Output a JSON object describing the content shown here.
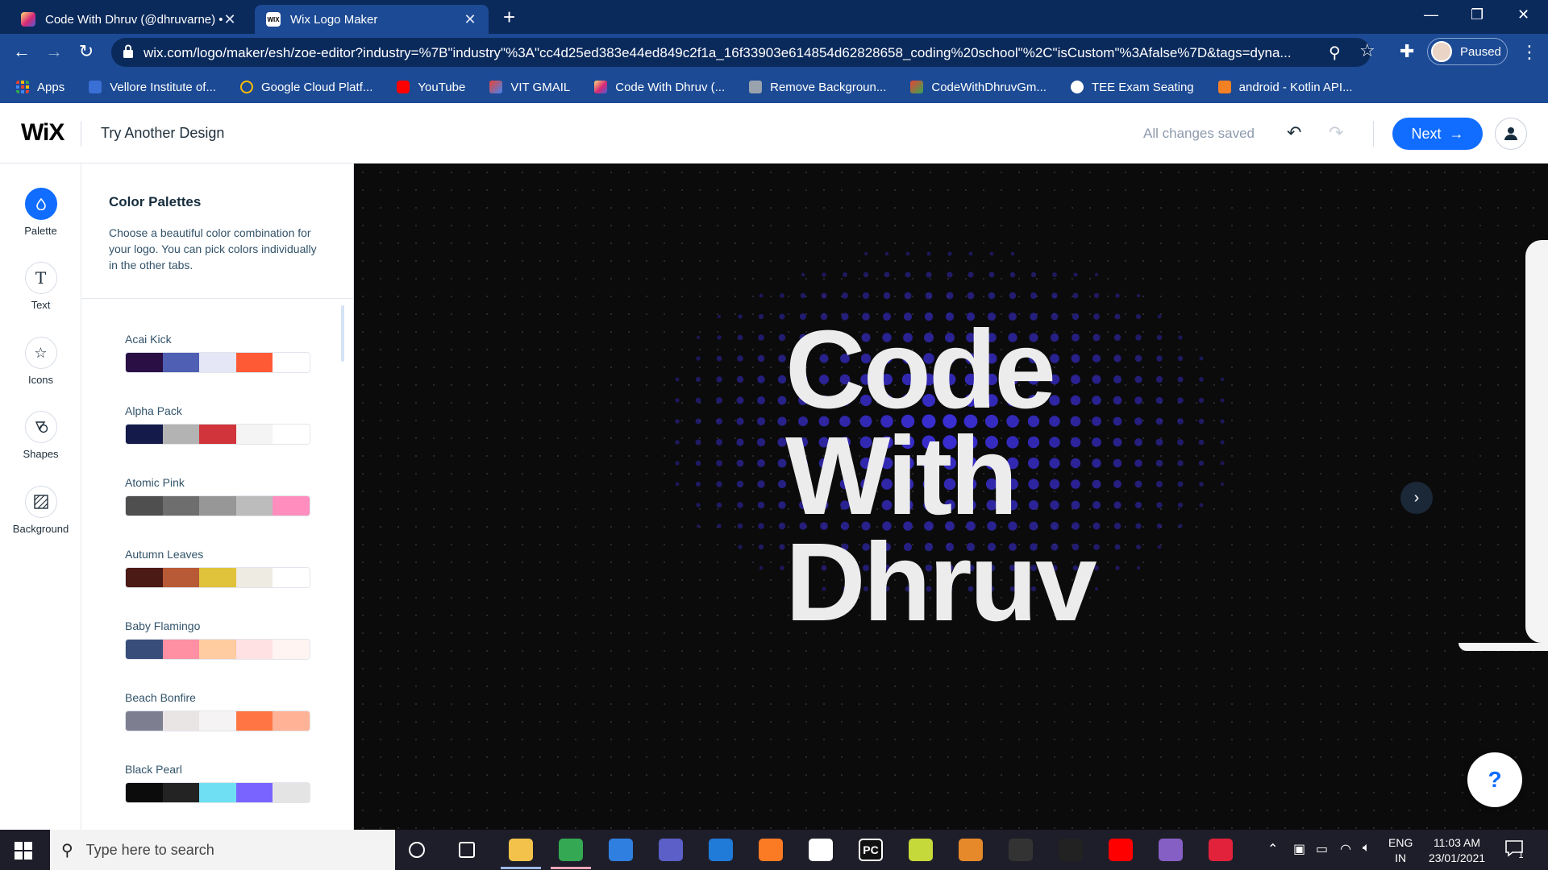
{
  "browser": {
    "tabs": [
      {
        "title": "Code With Dhruv (@dhruvarne) •",
        "icon": "instagram-icon"
      },
      {
        "title": "Wix Logo Maker",
        "icon": "wix-icon"
      }
    ],
    "url": "wix.com/logo/maker/esh/zoe-editor?industry=%7B\"industry\"%3A\"cc4d25ed383e44ed849c2f1a_16f33903e614854d62828658_coding%20school\"%2C\"isCustom\"%3Afalse%7D&tags=dyna...",
    "profile_label": "Paused",
    "bookmarks": [
      {
        "label": "Apps",
        "color": "#ea4335"
      },
      {
        "label": "Vellore Institute of...",
        "color": "#3a6fd6"
      },
      {
        "label": "Google Cloud Platf...",
        "color": "#fbbc05"
      },
      {
        "label": "YouTube",
        "color": "#ff0000"
      },
      {
        "label": "VIT GMAIL",
        "color": "#ea4335"
      },
      {
        "label": "Code With Dhruv (...",
        "color": "#d62976"
      },
      {
        "label": "Remove Backgroun...",
        "color": "#9aa3ad"
      },
      {
        "label": "CodeWithDhruvGm...",
        "color": "#ea4335"
      },
      {
        "label": "TEE Exam Seating",
        "color": "#ffffff"
      },
      {
        "label": "android - Kotlin API...",
        "color": "#f48024"
      }
    ]
  },
  "wix_header": {
    "logo": "WiX",
    "try_another": "Try Another Design",
    "status": "All changes saved",
    "next_label": "Next",
    "accent": "#116dff"
  },
  "rail": [
    {
      "label": "Palette",
      "icon": "palette-icon",
      "active": true
    },
    {
      "label": "Text",
      "icon": "text-icon",
      "active": false
    },
    {
      "label": "Icons",
      "icon": "star-icon",
      "active": false
    },
    {
      "label": "Shapes",
      "icon": "shapes-icon",
      "active": false
    },
    {
      "label": "Background",
      "icon": "background-icon",
      "active": false
    }
  ],
  "panel": {
    "title": "Color Palettes",
    "description": "Choose a beautiful color combination for your logo. You can pick colors individually in the other tabs.",
    "palettes": [
      {
        "name": "Acai Kick",
        "colors": [
          "#2a0f45",
          "#4f5fb3",
          "#e5e7f7",
          "#ff5a36",
          "#ffffff"
        ]
      },
      {
        "name": "Alpha Pack",
        "colors": [
          "#141a4a",
          "#b3b3b3",
          "#d1343a",
          "#f4f4f4",
          "#ffffff"
        ]
      },
      {
        "name": "Atomic Pink",
        "colors": [
          "#4f4f4f",
          "#6e6e6e",
          "#979797",
          "#bcbcbc",
          "#ff8ebf"
        ]
      },
      {
        "name": "Autumn Leaves",
        "colors": [
          "#4c1a14",
          "#b85a35",
          "#e0c23b",
          "#eeebe2",
          "#ffffff"
        ]
      },
      {
        "name": "Baby Flamingo",
        "colors": [
          "#384d7a",
          "#ff8fa3",
          "#ffcba0",
          "#ffe0e3",
          "#fff4f2"
        ]
      },
      {
        "name": "Beach Bonfire",
        "colors": [
          "#7d7f91",
          "#e9e5e5",
          "#f5f3f3",
          "#ff7644",
          "#ffb295"
        ]
      },
      {
        "name": "Black Pearl",
        "colors": [
          "#0c0c0c",
          "#232323",
          "#6fe0f3",
          "#7a64ff",
          "#e4e4e4"
        ]
      }
    ]
  },
  "canvas": {
    "logo_lines": [
      "Code",
      "With",
      "Dhruv"
    ],
    "text_color": "#ececec",
    "dot_color": "#3b2fd8",
    "help_label": "?"
  },
  "taskbar": {
    "search_placeholder": "Type here to search",
    "apps": [
      {
        "icon": "cortana-icon",
        "label": "",
        "color": "transparent"
      },
      {
        "icon": "task-view-icon",
        "label": "",
        "color": "transparent"
      },
      {
        "icon": "file-explorer-icon",
        "label": "",
        "color": "#f2c24b"
      },
      {
        "icon": "chrome-icon",
        "label": "",
        "color": "#34a853"
      },
      {
        "icon": "pycharm-edu-icon",
        "label": "",
        "color": "#2f7fe0"
      },
      {
        "icon": "teams-icon",
        "label": "",
        "color": "#5b5fc7"
      },
      {
        "icon": "vscode-icon",
        "label": "",
        "color": "#1f7ad8"
      },
      {
        "icon": "xampp-icon",
        "label": "",
        "color": "#fb7a24"
      },
      {
        "icon": "word-icon",
        "label": "",
        "color": "#ffffff"
      },
      {
        "icon": "pycharm-icon",
        "label": "PC",
        "color": "#111111"
      },
      {
        "icon": "git-icon",
        "label": "",
        "color": "#c5d93b"
      },
      {
        "icon": "fl-studio-icon",
        "label": "",
        "color": "#e6892a"
      },
      {
        "icon": "obs-icon",
        "label": "",
        "color": "#333333"
      },
      {
        "icon": "unity-icon",
        "label": "",
        "color": "#222222"
      },
      {
        "icon": "youtube-music-icon",
        "label": "",
        "color": "#ff0000"
      },
      {
        "icon": "visual-studio-icon",
        "label": "",
        "color": "#865fc5"
      },
      {
        "icon": "recorder-icon",
        "label": "",
        "color": "#e2213a"
      }
    ],
    "lang_top": "ENG",
    "lang_bottom": "IN",
    "time": "11:03 AM",
    "date": "23/01/2021",
    "notification_count": "1"
  }
}
